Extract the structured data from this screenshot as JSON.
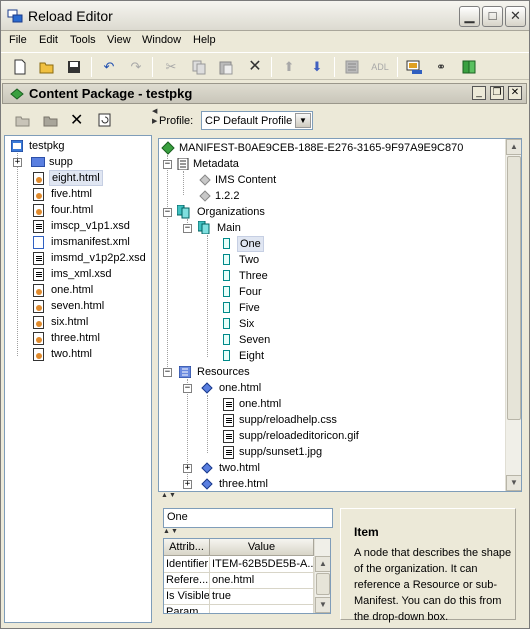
{
  "window": {
    "title": "Reload Editor"
  },
  "menu": [
    "File",
    "Edit",
    "Tools",
    "View",
    "Window",
    "Help"
  ],
  "toolbar": {
    "adl_label": "ADL",
    "icons": [
      "new-file-icon",
      "open-folder-icon",
      "save-icon",
      "undo-icon",
      "redo-icon",
      "cut-icon",
      "copy-icon",
      "paste-icon",
      "delete-icon",
      "move-up-icon",
      "move-down-icon",
      "document-icon",
      "adl-icon",
      "preview-icon",
      "binoculars-icon",
      "book-icon"
    ]
  },
  "inner_window": {
    "title": "Content Package - testpkg"
  },
  "left_tree": {
    "root": "testpkg",
    "items": [
      {
        "label": "supp",
        "icon": "folder"
      },
      {
        "label": "eight.html",
        "icon": "html"
      },
      {
        "label": "five.html",
        "icon": "html"
      },
      {
        "label": "four.html",
        "icon": "html"
      },
      {
        "label": "imscp_v1p1.xsd",
        "icon": "xsd"
      },
      {
        "label": "imsmanifest.xml",
        "icon": "xml"
      },
      {
        "label": "imsmd_v1p2p2.xsd",
        "icon": "xsd"
      },
      {
        "label": "ims_xml.xsd",
        "icon": "xsd"
      },
      {
        "label": "one.html",
        "icon": "html"
      },
      {
        "label": "seven.html",
        "icon": "html"
      },
      {
        "label": "six.html",
        "icon": "html"
      },
      {
        "label": "three.html",
        "icon": "html"
      },
      {
        "label": "two.html",
        "icon": "html"
      }
    ]
  },
  "profile": {
    "label": "Profile:",
    "value": "CP Default Profile"
  },
  "manifest_tree": {
    "manifest": "MANIFEST-B0AE9CEB-188E-E276-3165-9F97A9E9C870",
    "metadata": "Metadata",
    "metadata_children": [
      "IMS Content",
      "1.2.2"
    ],
    "organizations": "Organizations",
    "main": "Main",
    "items": [
      "One",
      "Two",
      "Three",
      "Four",
      "Five",
      "Six",
      "Seven",
      "Eight"
    ],
    "resources": "Resources",
    "resource_one": "one.html",
    "resource_one_files": [
      "one.html",
      "supp/reloadhelp.css",
      "supp/reloadeditoricon.gif",
      "supp/sunset1.jpg"
    ],
    "resource_two": "two.html",
    "resource_three": "three.html"
  },
  "editor": {
    "name_value": "One",
    "columns": [
      "Attrib...",
      "Value"
    ],
    "rows": [
      {
        "attr": "Identifier",
        "value": "ITEM-62B5DE5B-A..."
      },
      {
        "attr": "Refere...",
        "value": "one.html"
      },
      {
        "attr": "Is Visible",
        "value": "true"
      },
      {
        "attr": "Param...",
        "value": ""
      }
    ]
  },
  "help": {
    "title": "Item",
    "text": "A node that describes the shape of the organization. It can reference a Resource or sub-Manifest. You can do this from the drop-down box."
  }
}
